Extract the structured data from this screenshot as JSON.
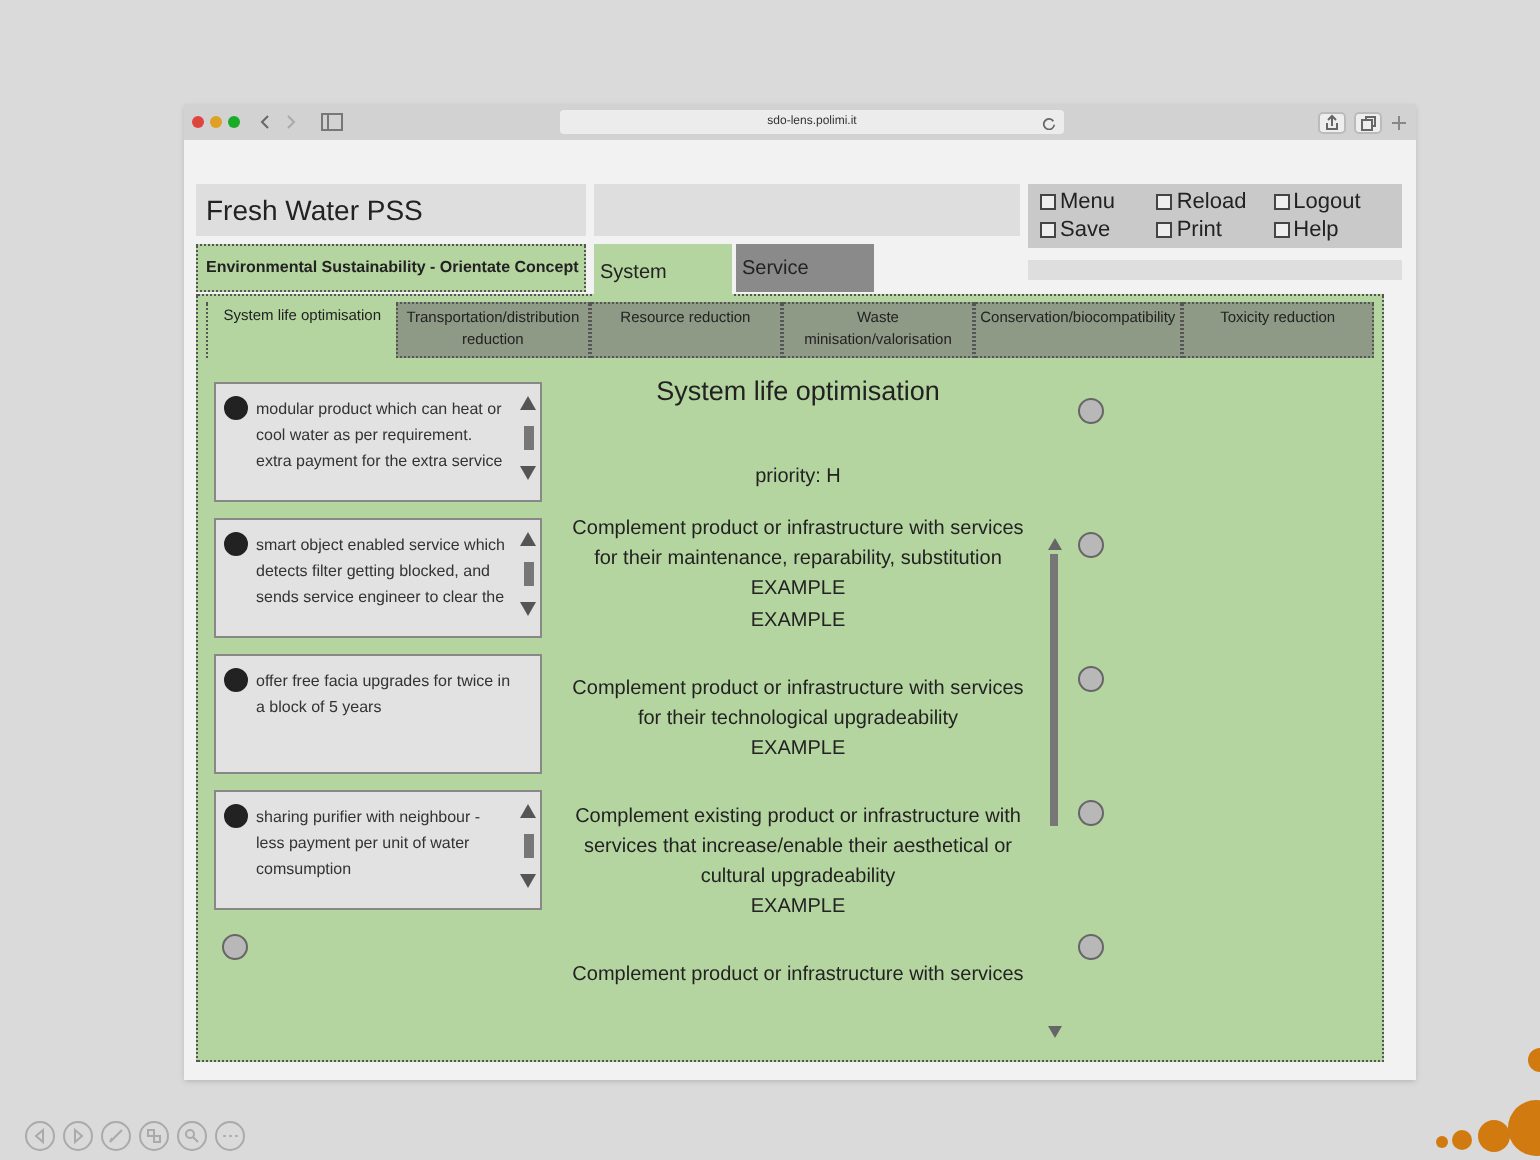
{
  "browser": {
    "url": "sdo-lens.polimi.it"
  },
  "header": {
    "title": "Fresh Water PSS",
    "checkboxes": [
      {
        "label": "Menu",
        "checked": false
      },
      {
        "label": "Reload",
        "checked": false
      },
      {
        "label": "Logout",
        "checked": false
      },
      {
        "label": "Save",
        "checked": false
      },
      {
        "label": "Print",
        "checked": false
      },
      {
        "label": "Help",
        "checked": false
      }
    ]
  },
  "concept": "Environmental Sustainability - Orientate Concept",
  "tabs": [
    {
      "label": "System",
      "selected": true
    },
    {
      "label": "Service",
      "selected": false
    }
  ],
  "subtabs": [
    {
      "label": "System life optimisation",
      "selected": true
    },
    {
      "label": "Transportation/distribution reduction",
      "selected": false
    },
    {
      "label": "Resource reduction",
      "selected": false
    },
    {
      "label": "Waste minisation/valorisation",
      "selected": false
    },
    {
      "label": "Conservation/biocompatibility",
      "selected": false
    },
    {
      "label": "Toxicity reduction",
      "selected": false
    }
  ],
  "ideas": [
    {
      "text": "modular product which can heat or cool water as per requirement. extra payment for the extra service",
      "marked": true,
      "scrollable": true
    },
    {
      "text": "smart object enabled service which detects filter getting blocked, and sends service engineer to clear the",
      "marked": true,
      "scrollable": true
    },
    {
      "text": "offer free facia upgrades for twice in a block of 5 years",
      "marked": true,
      "scrollable": false
    },
    {
      "text": "sharing purifier with neighbour - less payment per unit of water comsumption",
      "marked": true,
      "scrollable": true
    }
  ],
  "strategy": {
    "title": "System life optimisation",
    "priority": "priority: H",
    "guidelines": [
      {
        "text": "Complement product or infrastructure with services for their maintenance, reparability, substitution",
        "examples": [
          "EXAMPLE",
          "EXAMPLE"
        ]
      },
      {
        "text": "Complement product or infrastructure with services for their technological upgradeability",
        "examples": [
          "EXAMPLE"
        ]
      },
      {
        "text": "Complement existing product or infrastructure with services that increase/enable their aesthetical or cultural upgradeability",
        "examples": [
          "EXAMPLE"
        ]
      },
      {
        "text": "Complement product or infrastructure with services"
      }
    ]
  },
  "radios": [
    {
      "selected": false
    },
    {
      "selected": false
    },
    {
      "selected": false
    },
    {
      "selected": false
    },
    {
      "selected": false
    }
  ]
}
